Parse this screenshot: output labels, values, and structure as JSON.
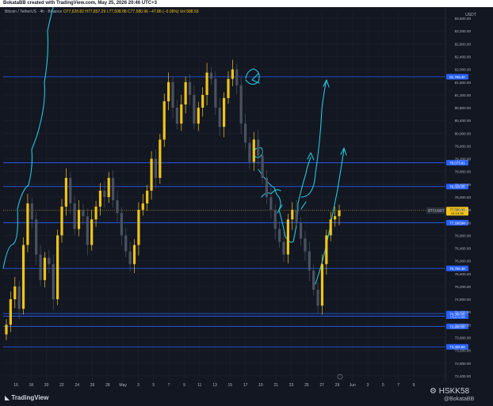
{
  "header": {
    "author_line": "BokataBB created with TradingView.com, May 25, 2026 20:46 UTC+3",
    "symbol_line": "Bitcoin / TetherUS · 4h · Binance",
    "ohlc": "O77,628.82 H77,857.29 L77,508.88 C77,580.96 −47.86 (−0.06%)",
    "volume": "Vol 588.59"
  },
  "axis": {
    "currency": "USDT",
    "price_labels": [
      "83,600.00",
      "83,200.00",
      "82,800.00",
      "82,400.00",
      "82,000.00",
      "81,600.00",
      "81,200.00",
      "80,800.00",
      "80,400.00",
      "80,000.00",
      "79,600.00",
      "79,200.00",
      "78,800.00",
      "78,400.00",
      "78,000.00",
      "77,600.00",
      "77,200.00",
      "76,800.00",
      "76,400.00",
      "76,000.00",
      "75,600.00",
      "75,200.00",
      "74,800.00",
      "74,400.00",
      "74,000.00",
      "73,600.00",
      "73,200.00",
      "72,800.00",
      "72,400.00"
    ],
    "date_labels": [
      "16",
      "18",
      "20",
      "22",
      "24",
      "26",
      "28",
      "May",
      "3",
      "5",
      "7",
      "9",
      "11",
      "13",
      "15",
      "17",
      "19",
      "21",
      "23",
      "25",
      "27",
      "29",
      "Jun",
      "3",
      "5",
      "7",
      "9"
    ]
  },
  "levels": {
    "values": [
      81768.3,
      79073.91,
      78329.05,
      77198.94,
      75766.38,
      74270.84,
      74350.0,
      73950.0,
      73309.98
    ],
    "labels": [
      "81,768.30",
      "79,073.91",
      "78,329.05",
      "77,198.94",
      "75,766.38",
      "74,270.84",
      "74,350.00",
      "73,950.00",
      "73,309.98"
    ],
    "color": "#2962ff"
  },
  "price_tag": {
    "symbol": "BTCUSDT",
    "value": "77,580.96",
    "countdown": "02:13:39",
    "color": "#f0c419"
  },
  "footer": {
    "logo": "TradingView",
    "watermark": "HSKK58",
    "watermark2": "@BokataBB"
  },
  "chart_data": {
    "type": "candlestick",
    "title": "",
    "xlabel": "",
    "ylabel": "",
    "ylim": [
      72200,
      83800
    ],
    "x_start": "16",
    "x_end": "9",
    "closes": [
      74000,
      74800,
      75200,
      74500,
      76500,
      77800,
      77300,
      76200,
      75400,
      76100,
      75900,
      74800,
      76800,
      77700,
      78600,
      77800,
      77000,
      77600,
      77400,
      76500,
      77300,
      77700,
      78200,
      78000,
      78600,
      77900,
      77500,
      76800,
      76300,
      75900,
      76500,
      77600,
      77800,
      78200,
      79200,
      78600,
      79800,
      81000,
      81600,
      80800,
      80300,
      80900,
      81600,
      81200,
      80300,
      80800,
      81200,
      81900,
      81700,
      80800,
      80200,
      81100,
      81700,
      82000,
      81500,
      80300,
      79700,
      79100,
      79800,
      79300,
      78600,
      78000,
      77600,
      77000,
      76600,
      76200,
      77300,
      77600,
      77200,
      76700,
      76300,
      75700,
      75100,
      74600,
      75900,
      76800,
      77300,
      77400,
      77580
    ]
  }
}
